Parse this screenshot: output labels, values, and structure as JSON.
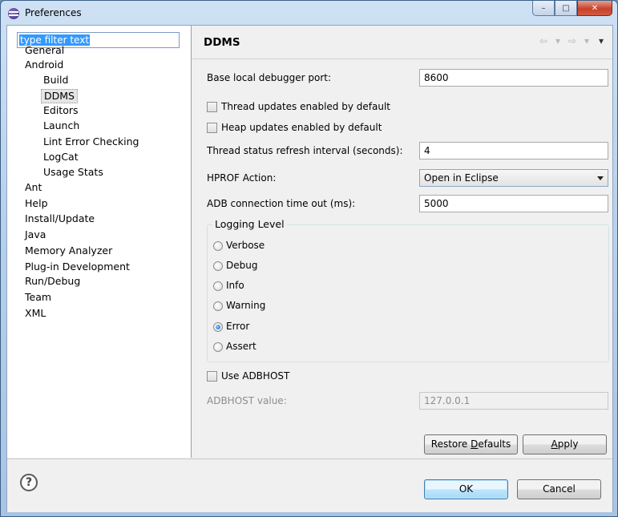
{
  "window": {
    "title": "Preferences",
    "minimize": "–",
    "maximize": "□",
    "close": "✕"
  },
  "filter": {
    "placeholder": "type filter text"
  },
  "tree": [
    "General",
    "Android",
    "Build",
    "DDMS",
    "Editors",
    "Launch",
    "Lint Error Checking",
    "LogCat",
    "Usage Stats",
    "Ant",
    "Help",
    "Install/Update",
    "Java",
    "Memory Analyzer",
    "Plug-in Development",
    "Run/Debug",
    "Team",
    "XML"
  ],
  "page": {
    "title": "DDMS",
    "nav": {
      "back": "⇦",
      "back_menu": "▾",
      "forward": "⇨",
      "forward_menu": "▾",
      "view_menu": "▾"
    },
    "debugger_port_label": "Base local debugger port:",
    "debugger_port_value": "8600",
    "thread_updates_label": "Thread updates enabled by default",
    "heap_updates_label": "Heap updates enabled by default",
    "thread_refresh_label": "Thread status refresh interval (seconds):",
    "thread_refresh_value": "4",
    "hprof_label": "HPROF Action:",
    "hprof_value": "Open in Eclipse",
    "adb_timeout_label": "ADB connection time out (ms):",
    "adb_timeout_value": "5000",
    "logging_group": "Logging Level",
    "logging_levels": [
      "Verbose",
      "Debug",
      "Info",
      "Warning",
      "Error",
      "Assert"
    ],
    "logging_selected": "Error",
    "use_adbhost_label": "Use ADBHOST",
    "adbhost_label": "ADBHOST value:",
    "adbhost_value": "127.0.0.1",
    "restore_defaults_pre": "Restore ",
    "restore_defaults_key": "D",
    "restore_defaults_post": "efaults",
    "apply_key": "A",
    "apply_post": "pply"
  },
  "footer": {
    "help": "?",
    "ok": "OK",
    "cancel": "Cancel"
  }
}
